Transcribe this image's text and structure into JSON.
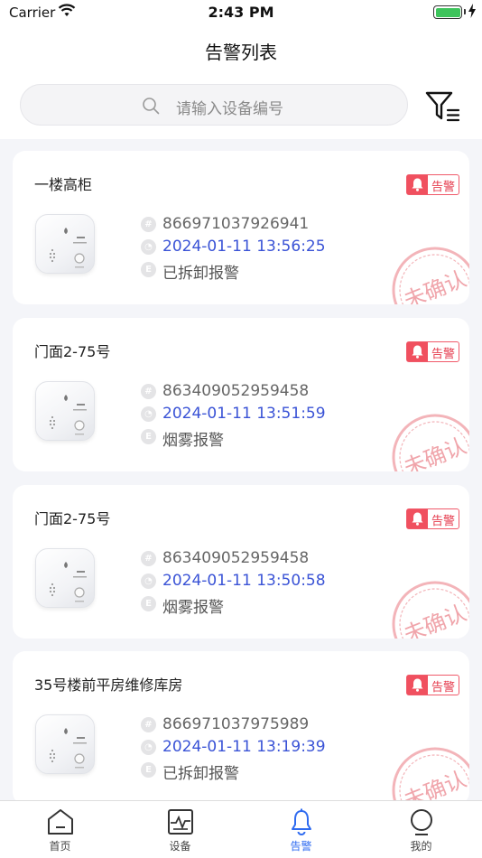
{
  "status_bar": {
    "carrier": "Carrier",
    "time": "2:43 PM"
  },
  "nav": {
    "title": "告警列表"
  },
  "search": {
    "placeholder": "请输入设备编号"
  },
  "alarm_label": "告警",
  "stamp_text": "未确认",
  "cards": [
    {
      "name": "一楼高柜",
      "device_id": "866971037926941",
      "time": "2024-01-11 13:56:25",
      "alarm_type": "已拆卸报警"
    },
    {
      "name": "门面2-75号",
      "device_id": "863409052959458",
      "time": "2024-01-11 13:51:59",
      "alarm_type": "烟雾报警"
    },
    {
      "name": "门面2-75号",
      "device_id": "863409052959458",
      "time": "2024-01-11 13:50:58",
      "alarm_type": "烟雾报警"
    },
    {
      "name": "35号楼前平房维修库房",
      "device_id": "866971037975989",
      "time": "2024-01-11 13:19:39",
      "alarm_type": "已拆卸报警"
    }
  ],
  "tabs": [
    {
      "label": "首页",
      "icon": "home-icon"
    },
    {
      "label": "设备",
      "icon": "device-icon"
    },
    {
      "label": "告警",
      "icon": "bell-icon",
      "active": true
    },
    {
      "label": "我的",
      "icon": "profile-icon"
    }
  ],
  "colors": {
    "accent": "#2f6bf0",
    "alarm": "#f0505f",
    "time_text": "#3a53d6"
  }
}
